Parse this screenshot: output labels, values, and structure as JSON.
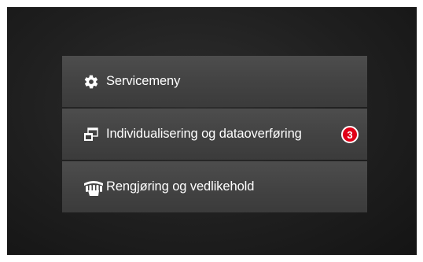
{
  "menu": {
    "items": [
      {
        "label": "Servicemeny",
        "icon": "gear-icon"
      },
      {
        "label": "Individualisering og dataoverføring",
        "icon": "windows-transfer-icon",
        "badge": "3"
      },
      {
        "label": "Rengjøring og vedlikehold",
        "icon": "cleaning-hand-icon"
      }
    ]
  },
  "colors": {
    "background": "#1f1f1f",
    "item": "#444444",
    "badge": "#e00016",
    "text": "#ffffff"
  }
}
